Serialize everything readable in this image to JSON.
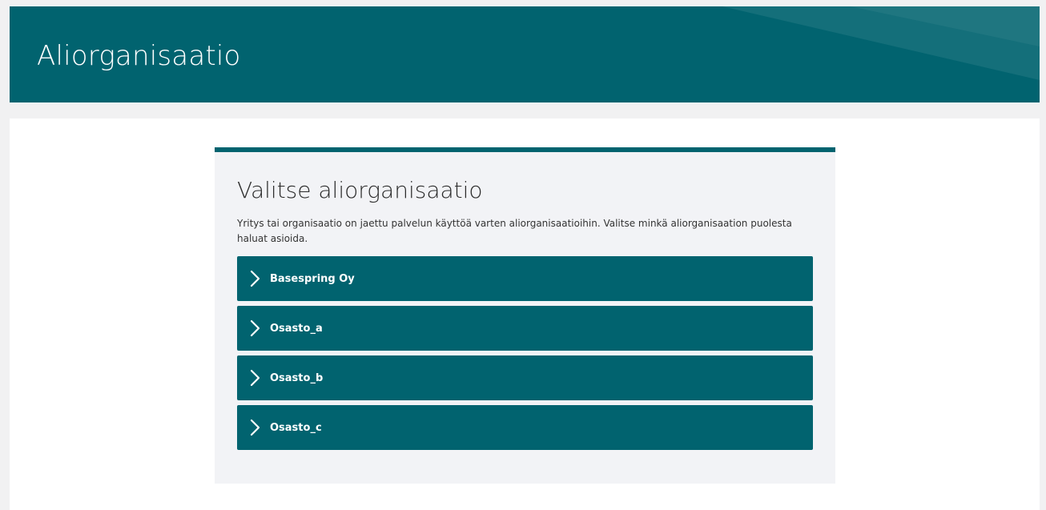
{
  "header": {
    "title": "Aliorganisaatio"
  },
  "card": {
    "title": "Valitse aliorganisaatio",
    "description": "Yritys tai organisaatio on jaettu palvelun käyttöä varten aliorganisaatioihin. Valitse minkä aliorganisaation puolesta haluat asioida."
  },
  "organizations": [
    {
      "label": "Basespring Oy",
      "icon": "chevron-right-icon"
    },
    {
      "label": "Osasto_a",
      "icon": "chevron-right-icon"
    },
    {
      "label": "Osasto_b",
      "icon": "chevron-right-icon"
    },
    {
      "label": "Osasto_c",
      "icon": "chevron-right-icon"
    }
  ],
  "colors": {
    "primary": "#01636f",
    "card_background": "#f2f3f6",
    "page_background": "#f1f1f2",
    "text": "#2b2b2b"
  }
}
